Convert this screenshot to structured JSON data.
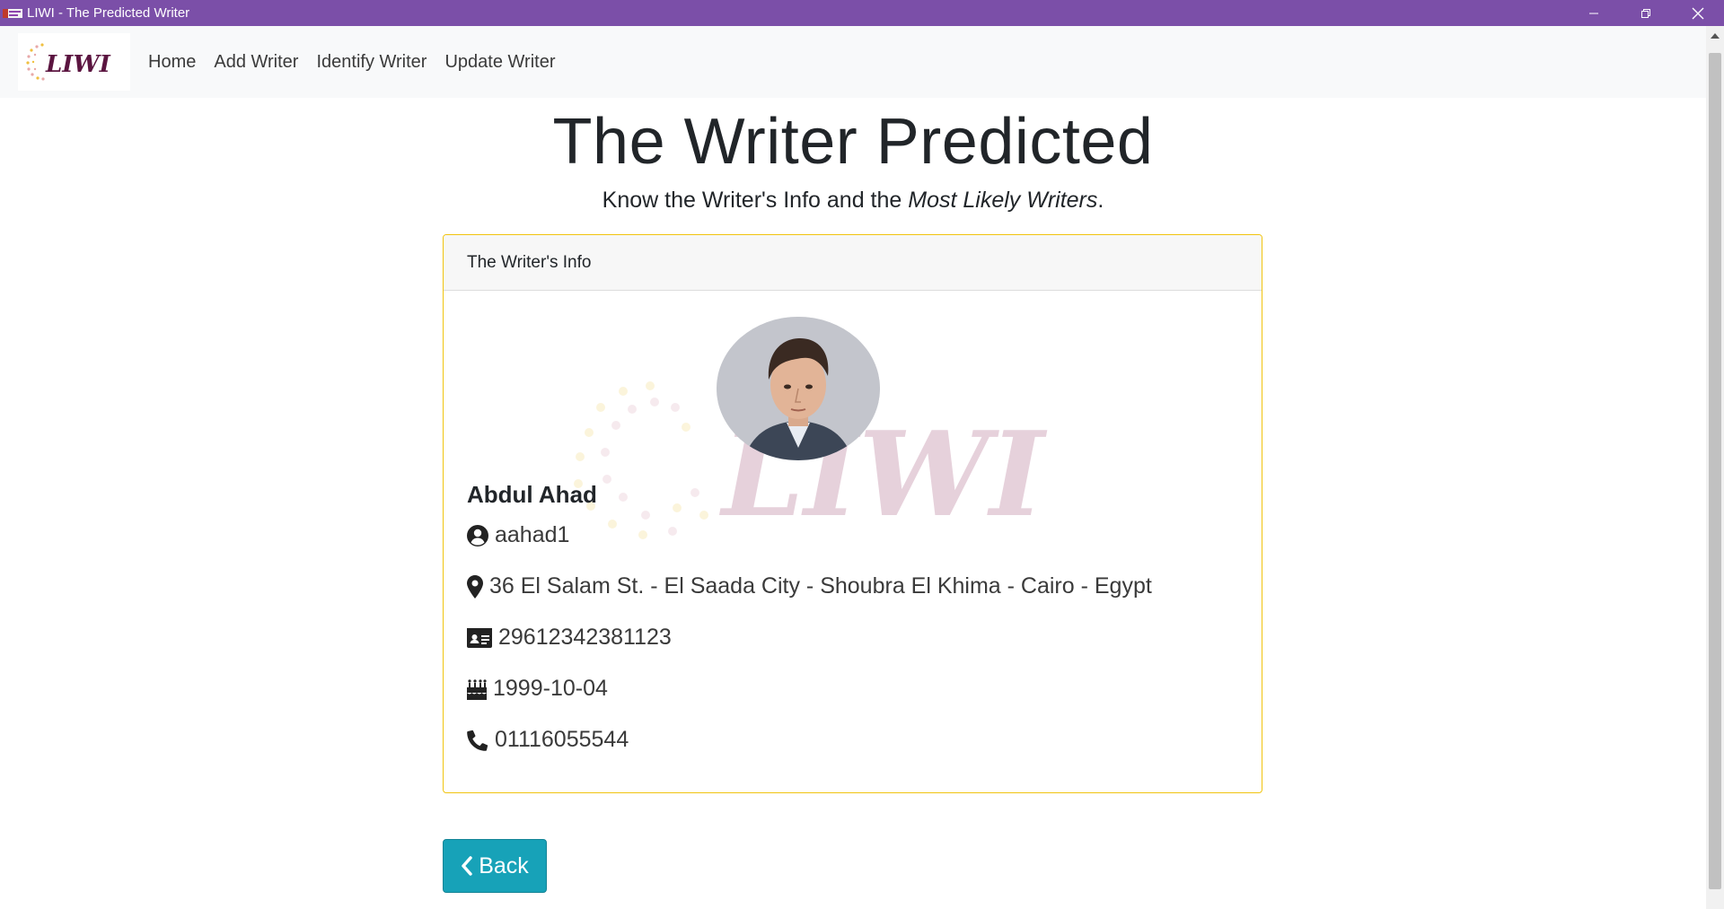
{
  "window": {
    "title": "LIWI - The Predicted Writer"
  },
  "navbar": {
    "brand": "LIWI",
    "links": [
      {
        "label": "Home"
      },
      {
        "label": "Add Writer"
      },
      {
        "label": "Identify Writer"
      },
      {
        "label": "Update Writer"
      }
    ]
  },
  "page": {
    "title": "The Writer Predicted",
    "lead_prefix": "Know the Writer's Info and the ",
    "lead_emphasis": "Most Likely Writers",
    "lead_suffix": "."
  },
  "card": {
    "header": "The Writer's Info",
    "watermark": "LIWI",
    "writer": {
      "name": "Abdul Ahad",
      "username": "aahad1",
      "address": "36 El Salam St. - El Saada City - Shoubra El Khima - Cairo - Egypt",
      "national_id": "29612342381123",
      "birthdate": "1999-10-04",
      "phone": "01116055544"
    }
  },
  "actions": {
    "back_label": "Back"
  },
  "colors": {
    "titlebar": "#7b4fa8",
    "navbar_bg": "#f8f9fa",
    "card_border": "#f1c40f",
    "button": "#17a2b8",
    "brand_text": "#5b1540"
  },
  "icons": {
    "username": "user-circle-icon",
    "address": "map-marker-icon",
    "national_id": "id-card-icon",
    "birthdate": "birthday-cake-icon",
    "phone": "phone-icon",
    "back": "chevron-left-icon"
  }
}
